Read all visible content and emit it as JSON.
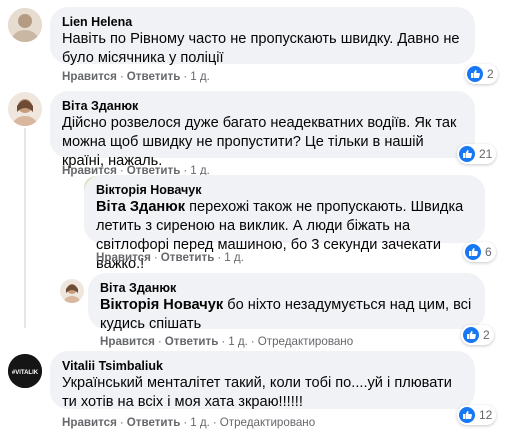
{
  "comments": [
    {
      "author": "Lien Helena",
      "text": "Навіть по Рівному часто не пропускають швидку. Давно не було місячника у поліції",
      "like_label": "Нравится",
      "reply_label": "Ответить",
      "time": "1 д.",
      "reaction_count": "2"
    },
    {
      "author": "Віта Зданюк",
      "text": "Дійсно розвелося дуже багато неадекватних водіїв. Як так можна щоб швидку не пропустити? Це тільки в нашій країні, нажаль.",
      "like_label": "Нравится",
      "reply_label": "Ответить",
      "time": "1 д.",
      "reaction_count": "21"
    },
    {
      "author": "Вікторія Новачук",
      "mention": "Віта Зданюк",
      "text": " перехожі також не пропускають. Швидка летить з сиреною на виклик. А люди біжать на світлофорі перед машиною, бо 3 секунди зачекати важко.!",
      "like_label": "Нравится",
      "reply_label": "Ответить",
      "time": "1 д.",
      "reaction_count": "6"
    },
    {
      "author": "Віта Зданюк",
      "mention": "Вікторія Новачук",
      "text": " бо ніхто незадумується над цим, всі кудись спішать",
      "like_label": "Нравится",
      "reply_label": "Ответить",
      "time": "1 д.",
      "edited": "Отредактировано",
      "reaction_count": "2"
    },
    {
      "author": "Vitalii Tsimbaliuk",
      "avatar_text": "#VITALIK",
      "text": "Український менталітет такий, коли тобі по....уй і плювати ти хотів на всіх і моя хата зкраю!!!!!!",
      "like_label": "Нравится",
      "reply_label": "Ответить",
      "time": "1 д.",
      "edited": "Отредактировано",
      "reaction_count": "12"
    }
  ],
  "colors": {
    "bubble": "#f0f2f5",
    "meta": "#65676b",
    "like_blue": "#1877f2"
  }
}
